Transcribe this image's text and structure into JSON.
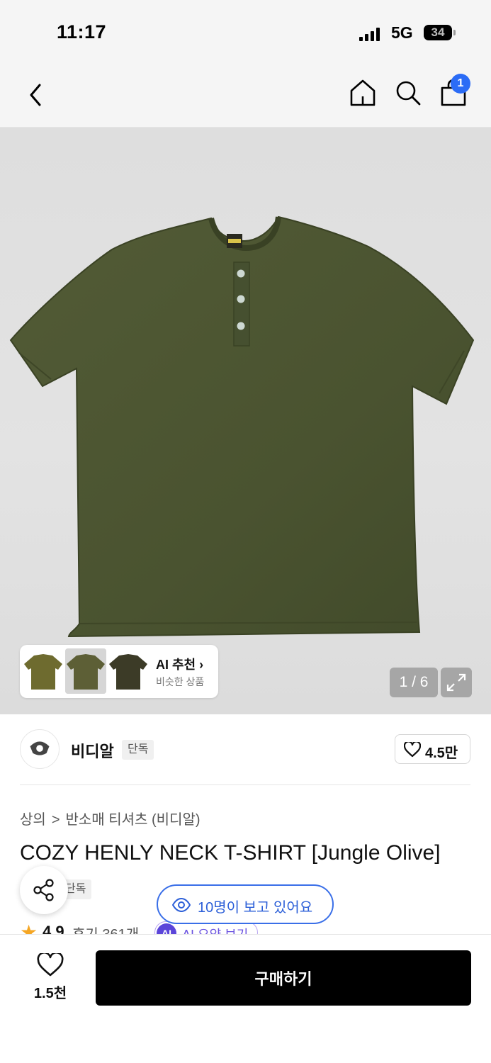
{
  "status_bar": {
    "time": "11:17",
    "network": "5G",
    "battery": "34"
  },
  "nav": {
    "cart_count": "1"
  },
  "gallery": {
    "ai_title": "AI 추천 ›",
    "ai_subtitle": "비슷한 상품",
    "pager": "1 / 6",
    "shirt_color": "#4c5531"
  },
  "brand": {
    "name": "비디알",
    "tag": "단독",
    "likes": "4.5만"
  },
  "product": {
    "breadcrumb": [
      "상의",
      "반소매 티셔츠 (비디알)"
    ],
    "breadcrumb_sep": ">",
    "title": "COZY HENLY NECK T-SHIRT [Jungle Olive]",
    "exclusive_tag": "단독",
    "viewers": "10명이 보고 있어요",
    "rating_star": "★",
    "rating": "4.9",
    "reviews": "후기 361개",
    "ai_chip_icon": "AI",
    "ai_chip_label": "AI 요약 보기"
  },
  "bottom": {
    "wish_count": "1.5천",
    "buy_label": "구매하기"
  },
  "colors": {
    "accent_blue": "#2b6cf6",
    "viewer_blue": "#3a6fe8",
    "buy_button": "#000000"
  }
}
